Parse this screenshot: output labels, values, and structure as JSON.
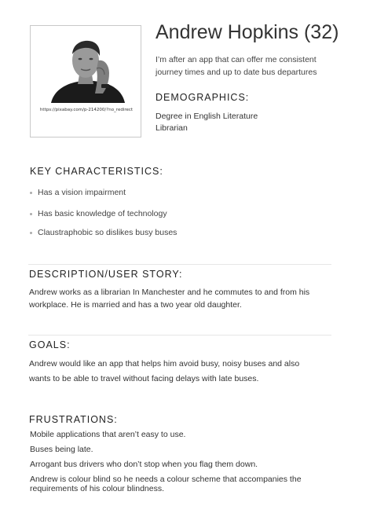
{
  "profile": {
    "name": "Andrew Hopkins (32)",
    "quote": "I’m after an app that can offer me consistent journey times and up to date bus departures",
    "photo_caption": "https://pixabay.com/p-214200/?no_redirect"
  },
  "demographics": {
    "heading": "DEMOGRAPHICS:",
    "items": [
      "Degree in English Literature",
      "Librarian"
    ]
  },
  "key_characteristics": {
    "heading": "KEY CHARACTERISTICS:",
    "items": [
      "Has a vision impairment",
      "Has basic knowledge of technology",
      "Claustraphobic so dislikes busy buses"
    ]
  },
  "description": {
    "heading": "DESCRIPTION/USER STORY:",
    "text": "Andrew works as a librarian In Manchester and he commutes to and from his workplace. He is married and has a two year old daughter."
  },
  "goals": {
    "heading": "GOALS:",
    "text": "Andrew would like an app that helps him avoid busy, noisy buses and also wants to be able to travel without facing delays with late buses."
  },
  "frustrations": {
    "heading": "FRUSTRATIONS:",
    "items": [
      "Mobile applications that aren’t easy to use.",
      "Buses being late.",
      "Arrogant bus drivers who don’t stop when you flag them down.",
      "Andrew is colour blind so he needs a colour scheme that accompanies the requirements of his colour blindness."
    ]
  }
}
